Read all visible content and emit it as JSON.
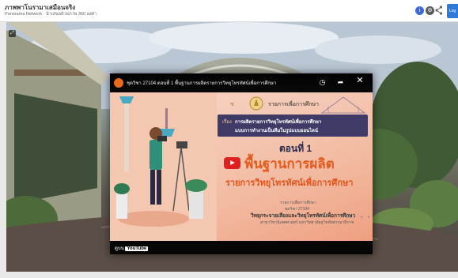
{
  "app": {
    "title": "ภาพพาโนรามาเสมือนจริง",
    "subtitle": "Panorama Network · นำเสนอด้วยภาพ 360 องศา"
  },
  "header_buttons": {
    "info_glyph": "i",
    "settings_glyph": "⚙",
    "login_label": "Log"
  },
  "video": {
    "title": "ชุดวิชา 27104 ตอนที่ 1 พื้นฐานการผลิตรายการวิทยุโทรทัศน์เพื่อการศึกษา",
    "channel_badge": "ดูบน",
    "youtube_word": "YouTube",
    "thumbnail": {
      "tiny_tag": "ซ",
      "programme": "รายการเพื่อการศึกษา",
      "topic_label": "เรื่อง",
      "topic_line1": "การผลิตรายการวิทยุโทรทัศน์เพื่อการศึกษา",
      "topic_line2": "แบบการทำงานเป็นทีมในรูปแบบออนไลน์",
      "episode": "ตอนที่ 1",
      "headline": "พื้นฐานการผลิต",
      "subline": "รายการวิทยุโทรทัศน์เพื่อการศึกษา",
      "credit1": "รายการเพื่อการศึกษา",
      "credit2": "ชุดวิชา 27104",
      "credit3": "วิทยุกระจายเสียงและวิทยุโทรทัศน์เพื่อการศึกษา",
      "credit4": "สาขาวิชานิเทศศาสตร์ มหาวิทยาลัยสุโขทัยธรรมาธิราช",
      "dots": "+ + + +"
    }
  },
  "controls": {
    "watch_later_glyph": "◷",
    "share_glyph": "➦",
    "close_glyph": "✕",
    "expand_glyph": "⤢"
  },
  "colors": {
    "headline": "#e55a1c",
    "topic_bg": "#3f3a66",
    "youtube_red": "#e02020",
    "accent_blue": "#2f7ad8"
  }
}
